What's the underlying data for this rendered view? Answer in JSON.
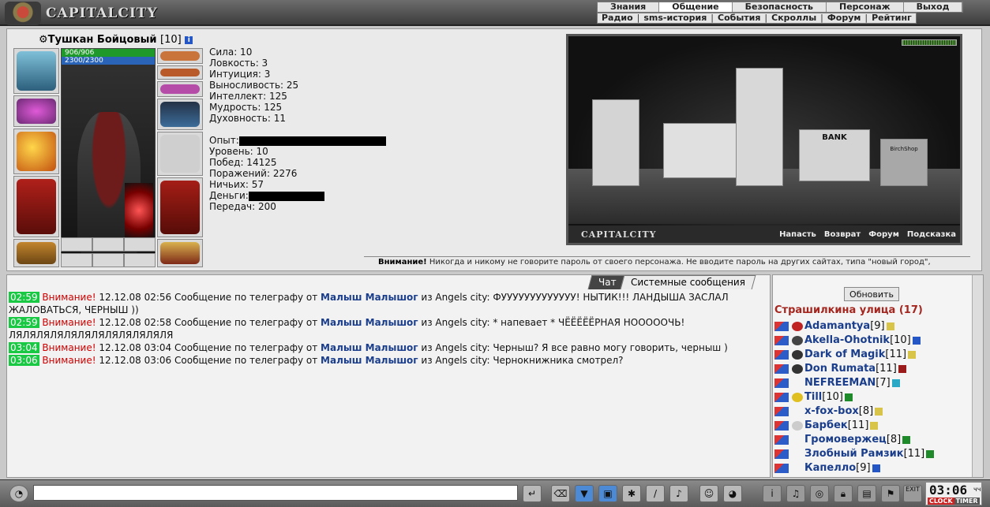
{
  "brand": "CAPITALCITY",
  "menu_primary": [
    "Знания",
    "Общение",
    "Безопасность",
    "Персонаж",
    "Выход"
  ],
  "menu_secondary": [
    "Радио",
    "sms-история",
    "События",
    "Скроллы",
    "Форум",
    "Рейтинг"
  ],
  "character": {
    "name": "Тушкан Бойцовый",
    "level": "[10]",
    "hp": "906/906",
    "mp": "2300/2300",
    "stats": [
      "Сила: 10",
      "Ловкость: 3",
      "Интуиция: 3",
      "Выносливость: 25",
      "Интеллект: 125",
      "Мудрость: 125",
      "Духовность: 11"
    ],
    "experience_label": "Опыт:",
    "level_line": "Уровень: 10",
    "wins": "Побед: 14125",
    "losses": "Поражений: 2276",
    "draws": "Ничьих: 57",
    "money_label": "Деньги:",
    "transfers": "Передач: 200"
  },
  "scene": {
    "brand": "CAPITALCITY",
    "bank_sign": "BANK",
    "shop_sign": "BirchShop",
    "links": [
      "Напасть",
      "Возврат",
      "Форум",
      "Подсказка"
    ]
  },
  "warning_strip": {
    "bold": "Внимание!",
    "text": " Никогда и никому не говорите пароль от своего персонажа. Не вводите пароль на других сайтах, типа \"новый город\","
  },
  "chat": {
    "tabs": [
      "Чат",
      "Системные сообщения"
    ],
    "messages": [
      {
        "time": "02:59",
        "warn": "Внимание!",
        "pre": " 12.12.08 02:56 Сообщение по телеграфу от ",
        "sender": "Малыш Малышог",
        "post": " из Angels city: ФУУУУУУУУУУУУУ! НЫТИК!!! ЛАНДЫША ЗАСЛАЛ ЖАЛОВАТЬСЯ, ЧЕРНЫШ ))"
      },
      {
        "time": "02:59",
        "warn": "Внимание!",
        "pre": " 12.12.08 02:58 Сообщение по телеграфу от ",
        "sender": "Малыш Малышог",
        "post": " из Angels city: * напевает * ЧЁЁЁЁЁРНАЯ НООООOЧЬ! ЛЯЛЯЛЯЛЯЛЯЛЯЛЯЛЯЛЯЛЯЛЯЛЯ"
      },
      {
        "time": "03:04",
        "warn": "Внимание!",
        "pre": " 12.12.08 03:04 Сообщение по телеграфу от ",
        "sender": "Малыш Малышог",
        "post": " из Angels city: Черныш? Я все равно могу говорить, черныш )"
      },
      {
        "time": "03:06",
        "warn": "Внимание!",
        "pre": " 12.12.08 03:06 Сообщение по телеграфу от ",
        "sender": "Малыш Малышог",
        "post": " из Angels city: Чернокнижника смотрел?"
      }
    ]
  },
  "location": {
    "refresh": "Обновить",
    "title": "Страшилкина улица (17)",
    "players": [
      {
        "nick": "Adamantya",
        "level": "[9]"
      },
      {
        "nick": "Akella-Ohotnik",
        "level": "[10]"
      },
      {
        "nick": "Dark of Magik",
        "level": "[11]"
      },
      {
        "nick": "Don Rumata",
        "level": "[11]"
      },
      {
        "nick": "NEFREEMAN",
        "level": "[7]"
      },
      {
        "nick": "Till",
        "level": "[10]"
      },
      {
        "nick": "x-fox-box",
        "level": "[8]"
      },
      {
        "nick": "Барбек",
        "level": "[11]"
      },
      {
        "nick": "Громовержец",
        "level": "[8]"
      },
      {
        "nick": "Злобный Рамзик",
        "level": "[11]"
      },
      {
        "nick": "Капелло",
        "level": "[9]"
      }
    ]
  },
  "clock": {
    "time": "03:06",
    "unit": "чч",
    "clock_label": "CLOCK",
    "timer_label": "TIMER"
  },
  "exit_label": "EXIT"
}
